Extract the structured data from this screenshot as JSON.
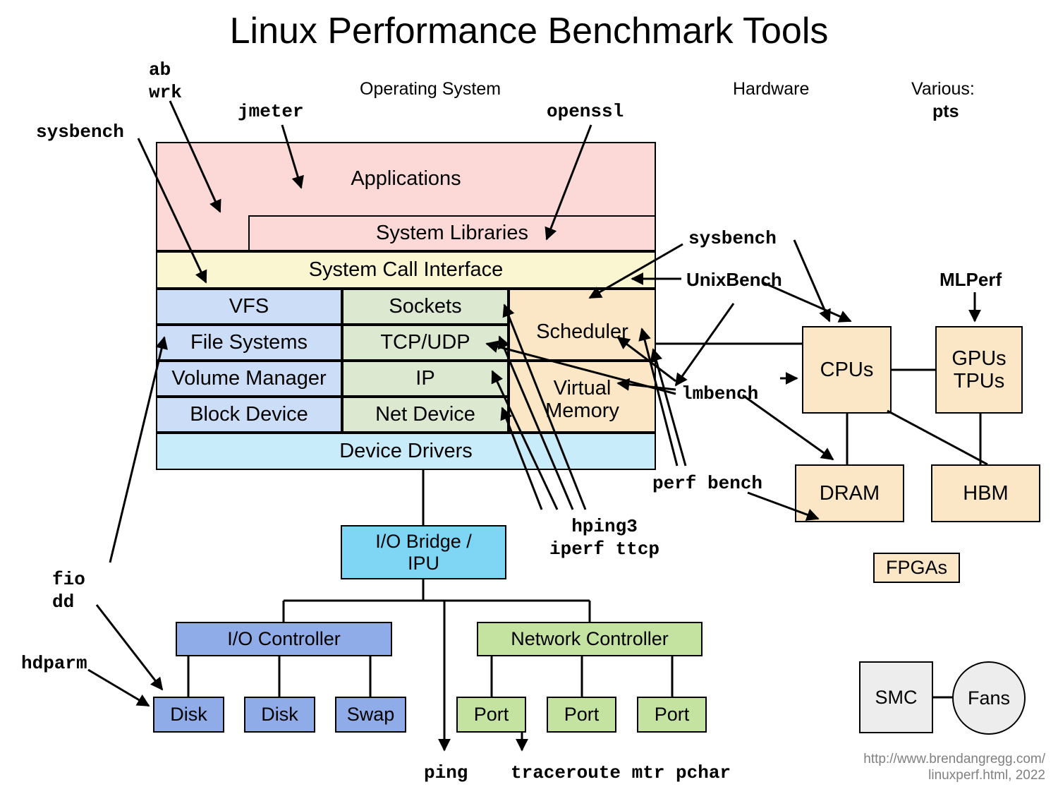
{
  "title": "Linux Performance Benchmark Tools",
  "section_labels": {
    "os": "Operating System",
    "hardware": "Hardware",
    "various_caption": "Various:",
    "various_tool": "pts"
  },
  "os_stack": {
    "applications": "Applications",
    "system_libraries": "System Libraries",
    "system_call_interface": "System Call Interface",
    "vfs": "VFS",
    "file_systems": "File Systems",
    "volume_manager": "Volume Manager",
    "block_device": "Block Device",
    "sockets": "Sockets",
    "tcp_udp": "TCP/UDP",
    "ip": "IP",
    "net_device": "Net Device",
    "scheduler": "Scheduler",
    "virtual_memory": "Virtual\nMemory",
    "device_drivers": "Device Drivers"
  },
  "io_tree": {
    "io_bridge": "I/O Bridge /\nIPU",
    "io_controller": "I/O Controller",
    "network_controller": "Network Controller",
    "disk1": "Disk",
    "disk2": "Disk",
    "swap": "Swap",
    "port1": "Port",
    "port2": "Port",
    "port3": "Port"
  },
  "hardware": {
    "cpus": "CPUs",
    "gpus_tpus": "GPUs\nTPUs",
    "dram": "DRAM",
    "hbm": "HBM",
    "fpgas": "FPGAs",
    "smc": "SMC",
    "fans": "Fans"
  },
  "tool_labels": {
    "ab_wrk": "ab\nwrk",
    "jmeter": "jmeter",
    "openssl": "openssl",
    "sysbench_left": "sysbench",
    "sysbench_right": "sysbench",
    "unixbench": "UnixBench",
    "mlperf": "MLPerf",
    "lmbench": "lmbench",
    "perf_bench": "perf bench",
    "hping3_iperf": "hping3\niperf ttcp",
    "fio_dd": "fio\ndd",
    "hdparm": "hdparm",
    "ping": "ping",
    "traceroute": "traceroute mtr pchar"
  },
  "credit": "http://www.brendangregg.com/\nlinuxperf.html, 2022",
  "colors": {
    "pink": "#fcd9d6",
    "cream": "#fbf6d2",
    "blue": "#ccddf7",
    "green": "#dce8d0",
    "orange": "#fbe7c6",
    "cyan": "#c9ecfa",
    "skyblue": "#7fd5f4",
    "medium_blue": "#8fabe8",
    "medium_green": "#c4e2a0",
    "grey": "#ededed",
    "credit_grey": "#808080"
  }
}
